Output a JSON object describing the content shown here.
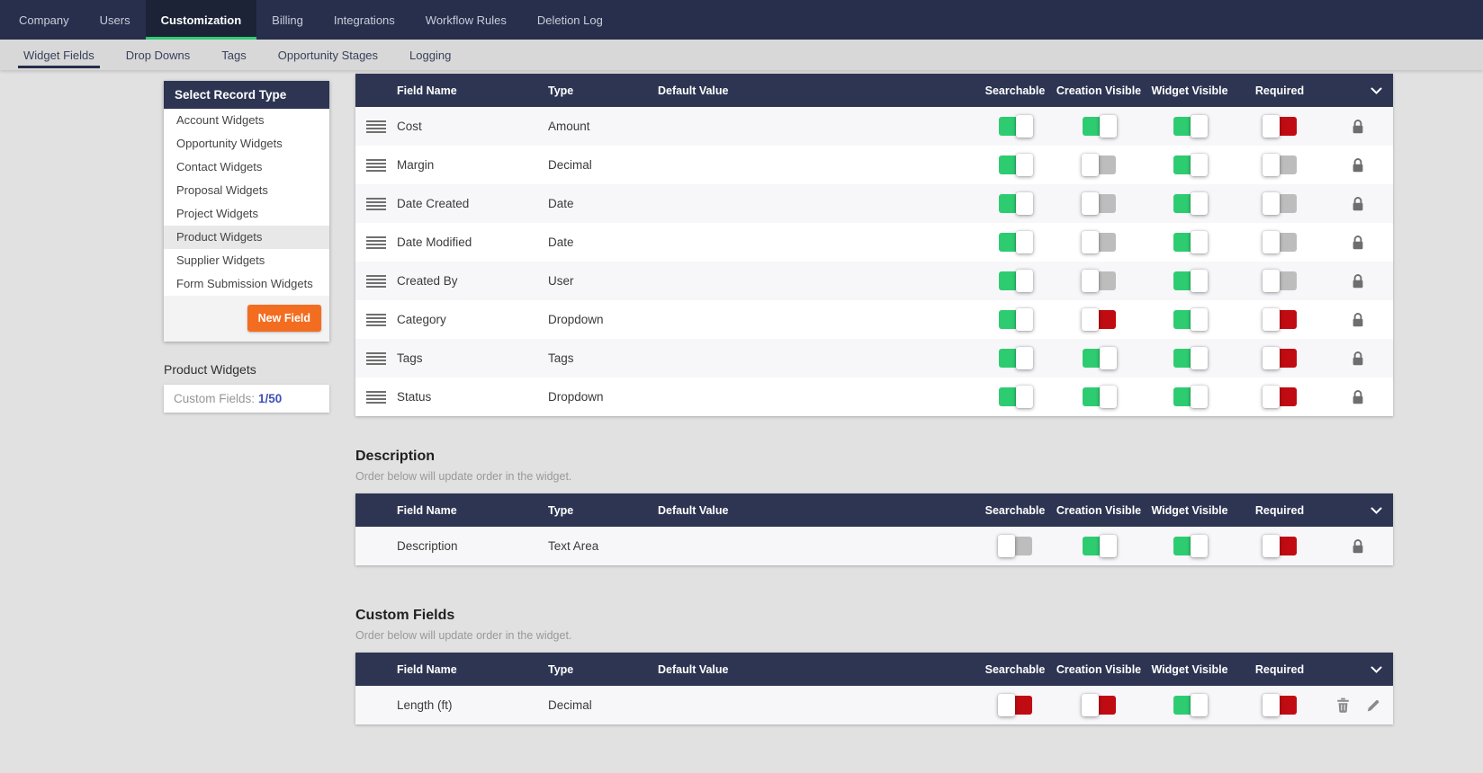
{
  "topnav": {
    "items": [
      {
        "label": "Company",
        "active": false
      },
      {
        "label": "Users",
        "active": false
      },
      {
        "label": "Customization",
        "active": true
      },
      {
        "label": "Billing",
        "active": false
      },
      {
        "label": "Integrations",
        "active": false
      },
      {
        "label": "Workflow Rules",
        "active": false
      },
      {
        "label": "Deletion Log",
        "active": false
      }
    ]
  },
  "subnav": {
    "items": [
      {
        "label": "Widget Fields",
        "active": true
      },
      {
        "label": "Drop Downs",
        "active": false
      },
      {
        "label": "Tags",
        "active": false
      },
      {
        "label": "Opportunity Stages",
        "active": false
      },
      {
        "label": "Logging",
        "active": false
      }
    ]
  },
  "sidebar": {
    "title": "Select Record Type",
    "items": [
      "Account Widgets",
      "Opportunity Widgets",
      "Contact Widgets",
      "Proposal Widgets",
      "Project Widgets",
      "Product Widgets",
      "Supplier Widgets",
      "Form Submission Widgets"
    ],
    "selected_item": "Product Widgets",
    "new_field_button": "New Field"
  },
  "record_summary": {
    "title": "Product Widgets",
    "counter_label": "Custom Fields:",
    "counter_value": "1/50"
  },
  "columns": {
    "field_name": "Field Name",
    "type": "Type",
    "default_value": "Default Value",
    "searchable": "Searchable",
    "creation_visible": "Creation Visible",
    "widget_visible": "Widget Visible",
    "required": "Required"
  },
  "sections": {
    "default_fields": {
      "rows": [
        {
          "field_name": "Cost",
          "type": "Amount",
          "default_value": "",
          "searchable": "green",
          "creation_visible": "green",
          "widget_visible": "green",
          "required": "red",
          "drag_handle": true,
          "actions": [
            "lock"
          ]
        },
        {
          "field_name": "Margin",
          "type": "Decimal",
          "default_value": "",
          "searchable": "green",
          "creation_visible": "gray",
          "widget_visible": "green",
          "required": "gray",
          "drag_handle": true,
          "actions": [
            "lock"
          ]
        },
        {
          "field_name": "Date Created",
          "type": "Date",
          "default_value": "",
          "searchable": "green",
          "creation_visible": "gray",
          "widget_visible": "green",
          "required": "gray",
          "drag_handle": true,
          "actions": [
            "lock"
          ]
        },
        {
          "field_name": "Date Modified",
          "type": "Date",
          "default_value": "",
          "searchable": "green",
          "creation_visible": "gray",
          "widget_visible": "green",
          "required": "gray",
          "drag_handle": true,
          "actions": [
            "lock"
          ]
        },
        {
          "field_name": "Created By",
          "type": "User",
          "default_value": "",
          "searchable": "green",
          "creation_visible": "gray",
          "widget_visible": "green",
          "required": "gray",
          "drag_handle": true,
          "actions": [
            "lock"
          ]
        },
        {
          "field_name": "Category",
          "type": "Dropdown",
          "default_value": "",
          "searchable": "green",
          "creation_visible": "red",
          "widget_visible": "green",
          "required": "red",
          "drag_handle": true,
          "actions": [
            "lock"
          ]
        },
        {
          "field_name": "Tags",
          "type": "Tags",
          "default_value": "",
          "searchable": "green",
          "creation_visible": "green",
          "widget_visible": "green",
          "required": "red",
          "drag_handle": true,
          "actions": [
            "lock"
          ]
        },
        {
          "field_name": "Status",
          "type": "Dropdown",
          "default_value": "",
          "searchable": "green",
          "creation_visible": "green",
          "widget_visible": "green",
          "required": "red",
          "drag_handle": true,
          "actions": [
            "lock"
          ]
        }
      ]
    },
    "description": {
      "title": "Description",
      "subtitle": "Order below will update order in the widget.",
      "rows": [
        {
          "field_name": "Description",
          "type": "Text Area",
          "default_value": "",
          "searchable": "gray",
          "creation_visible": "green",
          "widget_visible": "green",
          "required": "red",
          "drag_handle": false,
          "actions": [
            "lock"
          ]
        }
      ]
    },
    "custom_fields": {
      "title": "Custom Fields",
      "subtitle": "Order below will update order in the widget.",
      "rows": [
        {
          "field_name": "Length (ft)",
          "type": "Decimal",
          "default_value": "",
          "searchable": "red",
          "creation_visible": "red",
          "widget_visible": "green",
          "required": "red",
          "drag_handle": false,
          "actions": [
            "trash",
            "edit"
          ]
        }
      ]
    }
  },
  "icons": {
    "chevron_down": "v-chevron",
    "drag_handle": "four-bar-grip",
    "lock": "padlock",
    "trash": "trash-can",
    "edit": "pencil"
  },
  "colors": {
    "navy_header": "#2d3553",
    "topnav": "#282f4d",
    "active_tab_underline": "#2ecc71",
    "toggle_on_green": "#2ecc71",
    "toggle_off_gray": "#bdbdbd",
    "toggle_red": "#c00b13",
    "new_field_orange": "#f36d21",
    "counter_value_blue": "#3f51b5",
    "page_background": "#e1e1e1"
  }
}
